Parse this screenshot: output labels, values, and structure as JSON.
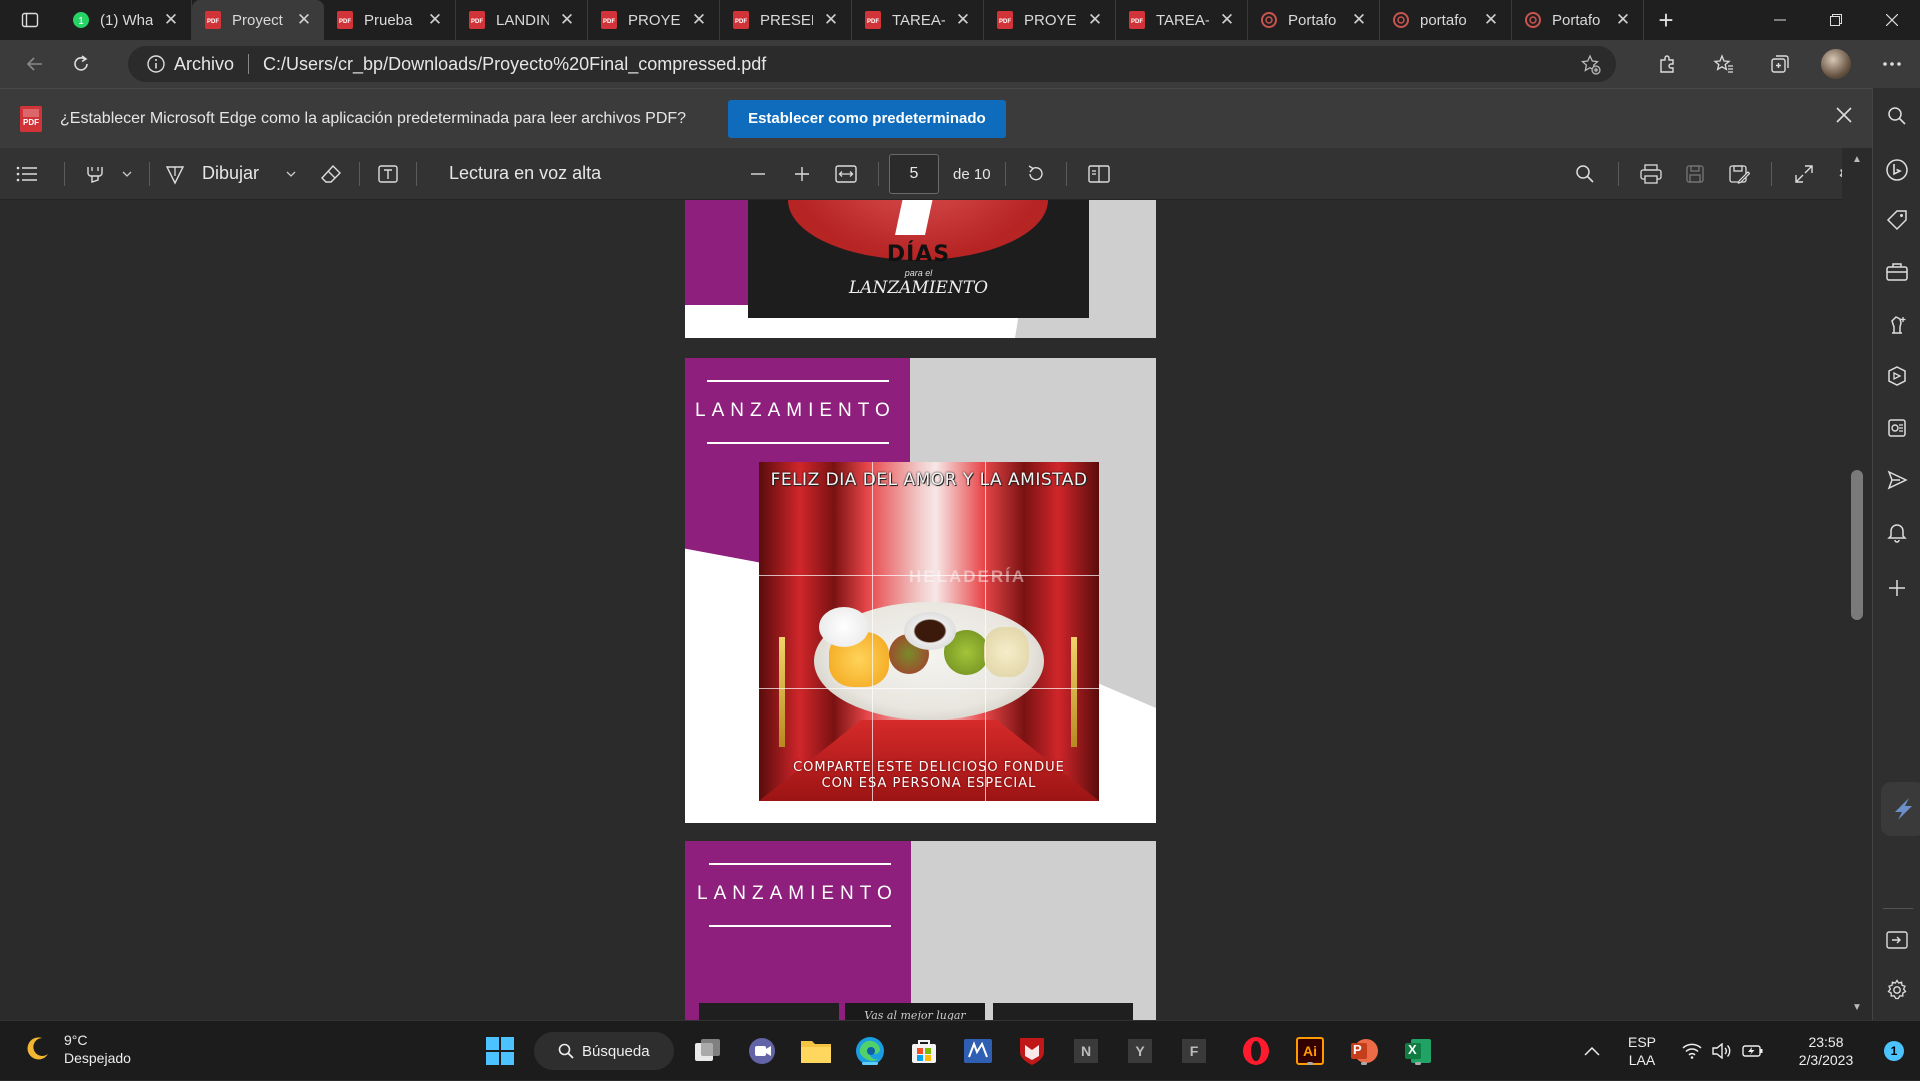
{
  "tabs": [
    {
      "title": "(1) Wha",
      "icon": "whatsapp-icon",
      "active": false
    },
    {
      "title": "Proyect",
      "icon": "pdf-icon",
      "active": true
    },
    {
      "title": "Prueba",
      "icon": "pdf-icon",
      "active": false
    },
    {
      "title": "LANDIN",
      "icon": "pdf-icon",
      "active": false
    },
    {
      "title": "PROYEC",
      "icon": "pdf-icon",
      "active": false
    },
    {
      "title": "PRESEN",
      "icon": "pdf-icon",
      "active": false
    },
    {
      "title": "TAREA-",
      "icon": "pdf-icon",
      "active": false
    },
    {
      "title": "PROYEC",
      "icon": "pdf-icon",
      "active": false
    },
    {
      "title": "TAREA-",
      "icon": "pdf-icon",
      "active": false
    },
    {
      "title": "Portafo",
      "icon": "portfolio-icon",
      "active": false
    },
    {
      "title": "portafo",
      "icon": "portfolio-icon",
      "active": false
    },
    {
      "title": "Portafo",
      "icon": "portfolio-icon",
      "active": false
    }
  ],
  "address": {
    "label": "Archivo",
    "url": "C:/Users/cr_bp/Downloads/Proyecto%20Final_compressed.pdf"
  },
  "infobar": {
    "message": "¿Establecer Microsoft Edge como la aplicación predeterminada para leer archivos PDF?",
    "button": "Establecer como predeterminado"
  },
  "pdf_toolbar": {
    "draw_label": "Dibujar",
    "read_aloud_label": "Lectura en voz alta",
    "current_page": "5",
    "page_of": "de 10"
  },
  "document": {
    "page_top": {
      "badge_main": "DÍAS",
      "badge_sub": "para el",
      "badge_script": "LANZAMIENTO"
    },
    "page_middle": {
      "heading": "LANZAMIENTO",
      "poster_title": "FELIZ DIA DEL AMOR Y LA AMISTAD",
      "poster_brand": "HELADERÍA",
      "poster_caption_1": "COMPARTE ESTE DELICIOSO FONDUE",
      "poster_caption_2": "CON ESA PERSONA ESPECIAL"
    },
    "page_bottom": {
      "heading": "LANZAMIENTO",
      "poster_peek": "Vas al mejor lugar"
    }
  },
  "taskbar": {
    "weather_temp": "9°C",
    "weather_desc": "Despejado",
    "search_label": "Búsqueda",
    "lang_1": "ESP",
    "lang_2": "LAA",
    "time": "23:58",
    "date": "2/3/2023",
    "notif_count": "1",
    "apps": [
      "windows-start",
      "task-view",
      "teams",
      "file-explorer",
      "edge",
      "store",
      "mail-app",
      "mcafee",
      "app-n",
      "app-y",
      "app-f",
      "opera",
      "illustrator",
      "powerpoint",
      "excel"
    ],
    "app_letters": {
      "n": "N",
      "y": "Y",
      "f": "F",
      "ai": "Ai",
      "p": "P",
      "x": "X"
    }
  },
  "colors": {
    "accent": "#0f6cbd",
    "purple": "#8e1f7c",
    "poster_red": "#c21d24"
  }
}
